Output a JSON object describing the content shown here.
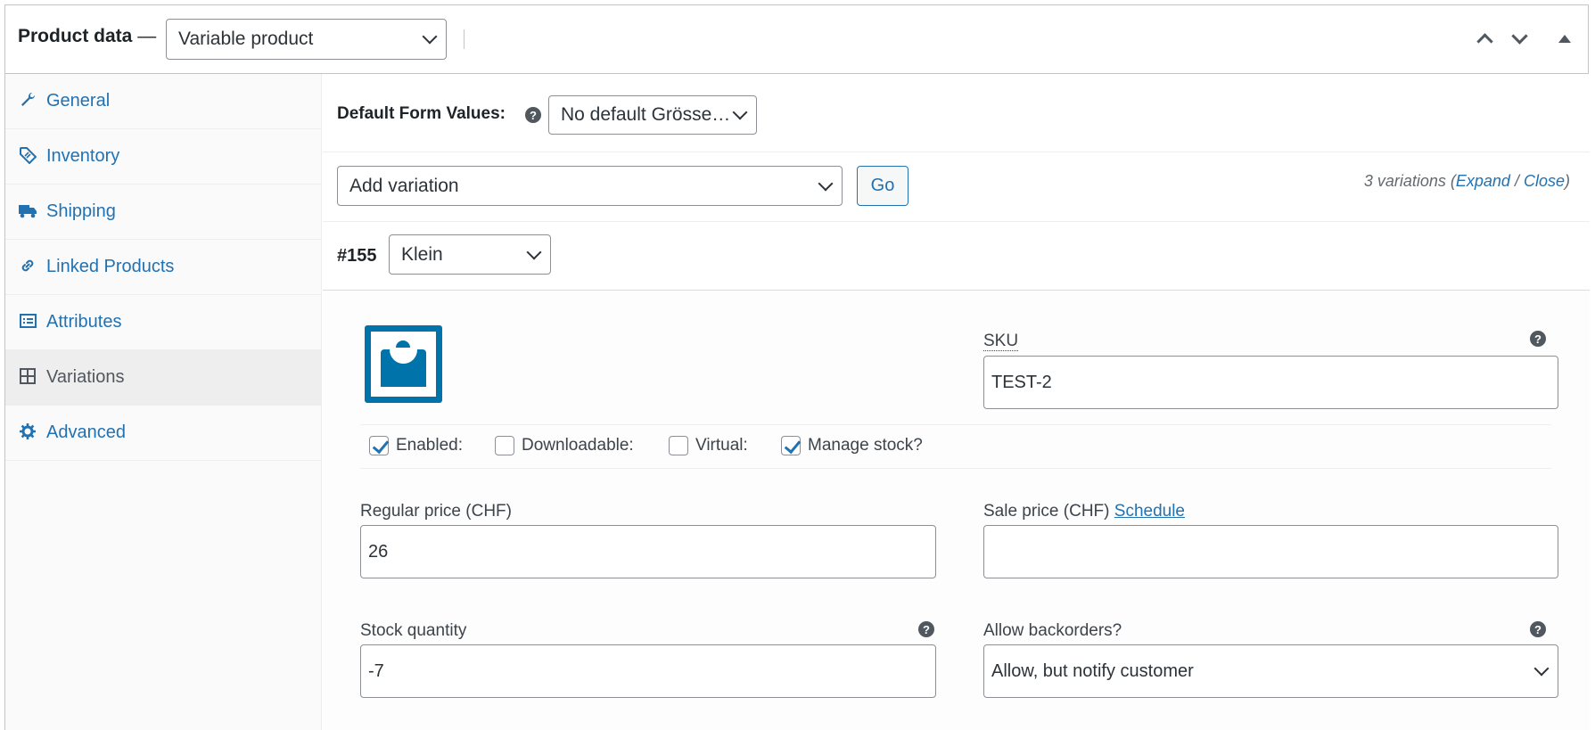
{
  "header": {
    "title": "Product data",
    "dash": "—",
    "product_type": "Variable product"
  },
  "sidebar": {
    "items": [
      {
        "label": "General",
        "icon": "wrench-icon",
        "active": false
      },
      {
        "label": "Inventory",
        "icon": "tag-icon",
        "active": false
      },
      {
        "label": "Shipping",
        "icon": "truck-icon",
        "active": false
      },
      {
        "label": "Linked Products",
        "icon": "link-icon",
        "active": false
      },
      {
        "label": "Attributes",
        "icon": "list-icon",
        "active": false
      },
      {
        "label": "Variations",
        "icon": "grid-icon",
        "active": true
      },
      {
        "label": "Advanced",
        "icon": "gear-icon",
        "active": false
      }
    ]
  },
  "defaults": {
    "label": "Default Form Values:",
    "value": "No default Grösse…"
  },
  "add_variation": {
    "value": "Add variation",
    "go_label": "Go",
    "count_text": "3 variations (",
    "expand": "Expand",
    "sep": " / ",
    "close": "Close",
    "close_paren": ")"
  },
  "variation": {
    "id": "#155",
    "size": "Klein",
    "sku_label": "SKU",
    "sku_value": "TEST-2",
    "checks": {
      "enabled": {
        "label": "Enabled:",
        "checked": true
      },
      "downloadable": {
        "label": "Downloadable:",
        "checked": false
      },
      "virtual": {
        "label": "Virtual:",
        "checked": false
      },
      "manage_stock": {
        "label": "Manage stock?",
        "checked": true
      }
    },
    "regular_price_label": "Regular price (CHF)",
    "regular_price_value": "26",
    "sale_price_label": "Sale price (CHF)",
    "schedule_link": "Schedule",
    "sale_price_value": "",
    "stock_label": "Stock quantity",
    "stock_value": "-7",
    "backorders_label": "Allow backorders?",
    "backorders_value": "Allow, but notify customer"
  },
  "help_glyph": "?",
  "colors": {
    "link": "#2271b1",
    "text": "#3c434a",
    "border": "#8c8f94"
  }
}
